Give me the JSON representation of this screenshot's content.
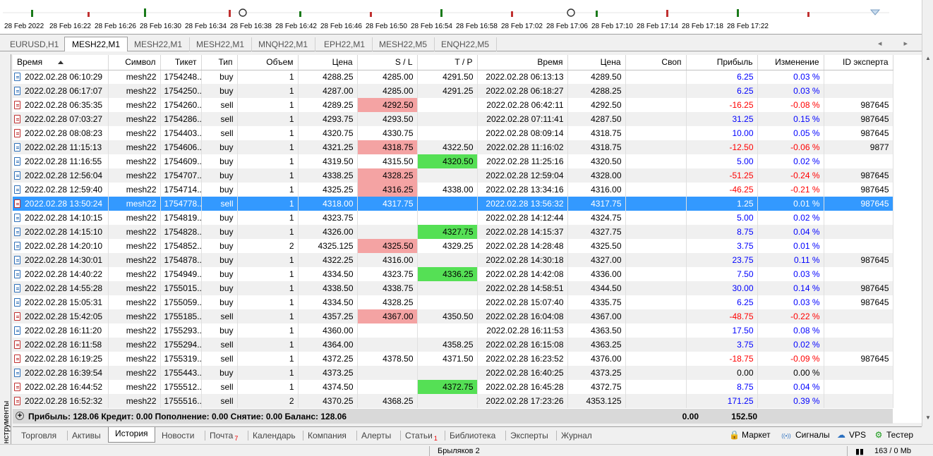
{
  "time_axis": [
    "28 Feb 2022",
    "28 Feb 16:22",
    "28 Feb 16:26",
    "28 Feb 16:30",
    "28 Feb 16:34",
    "28 Feb 16:38",
    "28 Feb 16:42",
    "28 Feb 16:46",
    "28 Feb 16:50",
    "28 Feb 16:54",
    "28 Feb 16:58",
    "28 Feb 17:02",
    "28 Feb 17:06",
    "28 Feb 17:10",
    "28 Feb 17:14",
    "28 Feb 17:18",
    "28 Feb 17:22"
  ],
  "chart_tabs": [
    {
      "label": "EURUSD,H1",
      "active": false
    },
    {
      "label": "MESH22,M1",
      "active": true
    },
    {
      "label": "MESH22,M1",
      "active": false
    },
    {
      "label": "MESH22,M1",
      "active": false
    },
    {
      "label": "MNQH22,M1",
      "active": false
    },
    {
      "label": "EPH22,M1",
      "active": false
    },
    {
      "label": "MESH22,M5",
      "active": false
    },
    {
      "label": "ENQH22,M5",
      "active": false
    }
  ],
  "tab_scroll_arrows": "◂ ▸",
  "side_label": "Инструменты",
  "columns": [
    "Время",
    "Символ",
    "Тикет",
    "Тип",
    "Объем",
    "Цена",
    "S / L",
    "T / P",
    "Время",
    "Цена",
    "Своп",
    "Прибыль",
    "Изменение",
    "ID эксперта"
  ],
  "rows": [
    {
      "open_time": "2022.02.28 06:10:29",
      "symbol": "mesh22",
      "ticket": "1754248...",
      "type": "buy",
      "volume": "1",
      "price": "4288.25",
      "sl": "4285.00",
      "tp": "4291.50",
      "close_time": "2022.02.28 06:13:13",
      "close_price": "4289.50",
      "swap": "",
      "profit": "6.25",
      "change": "0.03 %",
      "expert": "",
      "sl_hit": false,
      "tp_hit": false
    },
    {
      "open_time": "2022.02.28 06:17:07",
      "symbol": "mesh22",
      "ticket": "1754250...",
      "type": "buy",
      "volume": "1",
      "price": "4287.00",
      "sl": "4285.00",
      "tp": "4291.25",
      "close_time": "2022.02.28 06:18:27",
      "close_price": "4288.25",
      "swap": "",
      "profit": "6.25",
      "change": "0.03 %",
      "expert": "",
      "sl_hit": false,
      "tp_hit": false
    },
    {
      "open_time": "2022.02.28 06:35:35",
      "symbol": "mesh22",
      "ticket": "1754260...",
      "type": "sell",
      "volume": "1",
      "price": "4289.25",
      "sl": "4292.50",
      "tp": "",
      "close_time": "2022.02.28 06:42:11",
      "close_price": "4292.50",
      "swap": "",
      "profit": "-16.25",
      "change": "-0.08 %",
      "expert": "987645",
      "sl_hit": true,
      "tp_hit": false
    },
    {
      "open_time": "2022.02.28 07:03:27",
      "symbol": "mesh22",
      "ticket": "1754286...",
      "type": "sell",
      "volume": "1",
      "price": "4293.75",
      "sl": "4293.50",
      "tp": "",
      "close_time": "2022.02.28 07:11:41",
      "close_price": "4287.50",
      "swap": "",
      "profit": "31.25",
      "change": "0.15 %",
      "expert": "987645",
      "sl_hit": false,
      "tp_hit": false
    },
    {
      "open_time": "2022.02.28 08:08:23",
      "symbol": "mesh22",
      "ticket": "1754403...",
      "type": "sell",
      "volume": "1",
      "price": "4320.75",
      "sl": "4330.75",
      "tp": "",
      "close_time": "2022.02.28 08:09:14",
      "close_price": "4318.75",
      "swap": "",
      "profit": "10.00",
      "change": "0.05 %",
      "expert": "987645",
      "sl_hit": false,
      "tp_hit": false
    },
    {
      "open_time": "2022.02.28 11:15:13",
      "symbol": "mesh22",
      "ticket": "1754606...",
      "type": "buy",
      "volume": "1",
      "price": "4321.25",
      "sl": "4318.75",
      "tp": "4322.50",
      "close_time": "2022.02.28 11:16:02",
      "close_price": "4318.75",
      "swap": "",
      "profit": "-12.50",
      "change": "-0.06 %",
      "expert": "9877",
      "sl_hit": true,
      "tp_hit": false
    },
    {
      "open_time": "2022.02.28 11:16:55",
      "symbol": "mesh22",
      "ticket": "1754609...",
      "type": "buy",
      "volume": "1",
      "price": "4319.50",
      "sl": "4315.50",
      "tp": "4320.50",
      "close_time": "2022.02.28 11:25:16",
      "close_price": "4320.50",
      "swap": "",
      "profit": "5.00",
      "change": "0.02 %",
      "expert": "",
      "sl_hit": false,
      "tp_hit": true
    },
    {
      "open_time": "2022.02.28 12:56:04",
      "symbol": "mesh22",
      "ticket": "1754707...",
      "type": "buy",
      "volume": "1",
      "price": "4338.25",
      "sl": "4328.25",
      "tp": "",
      "close_time": "2022.02.28 12:59:04",
      "close_price": "4328.00",
      "swap": "",
      "profit": "-51.25",
      "change": "-0.24 %",
      "expert": "987645",
      "sl_hit": true,
      "tp_hit": false
    },
    {
      "open_time": "2022.02.28 12:59:40",
      "symbol": "mesh22",
      "ticket": "1754714...",
      "type": "buy",
      "volume": "1",
      "price": "4325.25",
      "sl": "4316.25",
      "tp": "4338.00",
      "close_time": "2022.02.28 13:34:16",
      "close_price": "4316.00",
      "swap": "",
      "profit": "-46.25",
      "change": "-0.21 %",
      "expert": "987645",
      "sl_hit": true,
      "tp_hit": false
    },
    {
      "open_time": "2022.02.28 13:50:24",
      "symbol": "mesh22",
      "ticket": "1754778...",
      "type": "sell",
      "volume": "1",
      "price": "4318.00",
      "sl": "4317.75",
      "tp": "",
      "close_time": "2022.02.28 13:56:32",
      "close_price": "4317.75",
      "swap": "",
      "profit": "1.25",
      "change": "0.01 %",
      "expert": "987645",
      "sl_hit": false,
      "tp_hit": false,
      "selected": true
    },
    {
      "open_time": "2022.02.28 14:10:15",
      "symbol": "mesh22",
      "ticket": "1754819...",
      "type": "buy",
      "volume": "1",
      "price": "4323.75",
      "sl": "",
      "tp": "",
      "close_time": "2022.02.28 14:12:44",
      "close_price": "4324.75",
      "swap": "",
      "profit": "5.00",
      "change": "0.02 %",
      "expert": "",
      "sl_hit": false,
      "tp_hit": false
    },
    {
      "open_time": "2022.02.28 14:15:10",
      "symbol": "mesh22",
      "ticket": "1754828...",
      "type": "buy",
      "volume": "1",
      "price": "4326.00",
      "sl": "",
      "tp": "4327.75",
      "close_time": "2022.02.28 14:15:37",
      "close_price": "4327.75",
      "swap": "",
      "profit": "8.75",
      "change": "0.04 %",
      "expert": "",
      "sl_hit": false,
      "tp_hit": true
    },
    {
      "open_time": "2022.02.28 14:20:10",
      "symbol": "mesh22",
      "ticket": "1754852...",
      "type": "buy",
      "volume": "2",
      "price": "4325.125",
      "sl": "4325.50",
      "tp": "4329.25",
      "close_time": "2022.02.28 14:28:48",
      "close_price": "4325.50",
      "swap": "",
      "profit": "3.75",
      "change": "0.01 %",
      "expert": "",
      "sl_hit": true,
      "tp_hit": false
    },
    {
      "open_time": "2022.02.28 14:30:01",
      "symbol": "mesh22",
      "ticket": "1754878...",
      "type": "buy",
      "volume": "1",
      "price": "4322.25",
      "sl": "4316.00",
      "tp": "",
      "close_time": "2022.02.28 14:30:18",
      "close_price": "4327.00",
      "swap": "",
      "profit": "23.75",
      "change": "0.11 %",
      "expert": "987645",
      "sl_hit": false,
      "tp_hit": false
    },
    {
      "open_time": "2022.02.28 14:40:22",
      "symbol": "mesh22",
      "ticket": "1754949...",
      "type": "buy",
      "volume": "1",
      "price": "4334.50",
      "sl": "4323.75",
      "tp": "4336.25",
      "close_time": "2022.02.28 14:42:08",
      "close_price": "4336.00",
      "swap": "",
      "profit": "7.50",
      "change": "0.03 %",
      "expert": "",
      "sl_hit": false,
      "tp_hit": true
    },
    {
      "open_time": "2022.02.28 14:55:28",
      "symbol": "mesh22",
      "ticket": "1755015...",
      "type": "buy",
      "volume": "1",
      "price": "4338.50",
      "sl": "4338.75",
      "tp": "",
      "close_time": "2022.02.28 14:58:51",
      "close_price": "4344.50",
      "swap": "",
      "profit": "30.00",
      "change": "0.14 %",
      "expert": "987645",
      "sl_hit": false,
      "tp_hit": false
    },
    {
      "open_time": "2022.02.28 15:05:31",
      "symbol": "mesh22",
      "ticket": "1755059...",
      "type": "buy",
      "volume": "1",
      "price": "4334.50",
      "sl": "4328.25",
      "tp": "",
      "close_time": "2022.02.28 15:07:40",
      "close_price": "4335.75",
      "swap": "",
      "profit": "6.25",
      "change": "0.03 %",
      "expert": "987645",
      "sl_hit": false,
      "tp_hit": false
    },
    {
      "open_time": "2022.02.28 15:42:05",
      "symbol": "mesh22",
      "ticket": "1755185...",
      "type": "sell",
      "volume": "1",
      "price": "4357.25",
      "sl": "4367.00",
      "tp": "4350.50",
      "close_time": "2022.02.28 16:04:08",
      "close_price": "4367.00",
      "swap": "",
      "profit": "-48.75",
      "change": "-0.22 %",
      "expert": "",
      "sl_hit": true,
      "tp_hit": false
    },
    {
      "open_time": "2022.02.28 16:11:20",
      "symbol": "mesh22",
      "ticket": "1755293...",
      "type": "buy",
      "volume": "1",
      "price": "4360.00",
      "sl": "",
      "tp": "",
      "close_time": "2022.02.28 16:11:53",
      "close_price": "4363.50",
      "swap": "",
      "profit": "17.50",
      "change": "0.08 %",
      "expert": "",
      "sl_hit": false,
      "tp_hit": false
    },
    {
      "open_time": "2022.02.28 16:11:58",
      "symbol": "mesh22",
      "ticket": "1755294...",
      "type": "sell",
      "volume": "1",
      "price": "4364.00",
      "sl": "",
      "tp": "4358.25",
      "close_time": "2022.02.28 16:15:08",
      "close_price": "4363.25",
      "swap": "",
      "profit": "3.75",
      "change": "0.02 %",
      "expert": "",
      "sl_hit": false,
      "tp_hit": false
    },
    {
      "open_time": "2022.02.28 16:19:25",
      "symbol": "mesh22",
      "ticket": "1755319...",
      "type": "sell",
      "volume": "1",
      "price": "4372.25",
      "sl": "4378.50",
      "tp": "4371.50",
      "close_time": "2022.02.28 16:23:52",
      "close_price": "4376.00",
      "swap": "",
      "profit": "-18.75",
      "change": "-0.09 %",
      "expert": "987645",
      "sl_hit": false,
      "tp_hit": false
    },
    {
      "open_time": "2022.02.28 16:39:54",
      "symbol": "mesh22",
      "ticket": "1755443...",
      "type": "buy",
      "volume": "1",
      "price": "4373.25",
      "sl": "",
      "tp": "",
      "close_time": "2022.02.28 16:40:25",
      "close_price": "4373.25",
      "swap": "",
      "profit": "0.00",
      "change": "0.00 %",
      "expert": "",
      "sl_hit": false,
      "tp_hit": false
    },
    {
      "open_time": "2022.02.28 16:44:52",
      "symbol": "mesh22",
      "ticket": "1755512...",
      "type": "sell",
      "volume": "1",
      "price": "4374.50",
      "sl": "",
      "tp": "4372.75",
      "close_time": "2022.02.28 16:45:28",
      "close_price": "4372.75",
      "swap": "",
      "profit": "8.75",
      "change": "0.04 %",
      "expert": "",
      "sl_hit": false,
      "tp_hit": true
    },
    {
      "open_time": "2022.02.28 16:52:32",
      "symbol": "mesh22",
      "ticket": "1755516...",
      "type": "sell",
      "volume": "2",
      "price": "4370.25",
      "sl": "4368.25",
      "tp": "",
      "close_time": "2022.02.28 17:23:26",
      "close_price": "4353.125",
      "swap": "",
      "profit": "171.25",
      "change": "0.39 %",
      "expert": "",
      "sl_hit": false,
      "tp_hit": false
    }
  ],
  "summary": {
    "text": "Прибыль: 128.06  Кредит: 0.00  Пополнение: 0.00  Снятие: 0.00  Баланс: 128.06",
    "swap": "0.00",
    "profit": "152.50"
  },
  "bottom_tabs": [
    {
      "label": "Торговля",
      "active": false,
      "badge": ""
    },
    {
      "label": "Активы",
      "active": false,
      "badge": ""
    },
    {
      "label": "История",
      "active": true,
      "badge": ""
    },
    {
      "label": "Новости",
      "active": false,
      "badge": ""
    },
    {
      "label": "Почта",
      "active": false,
      "badge": "7"
    },
    {
      "label": "Календарь",
      "active": false,
      "badge": ""
    },
    {
      "label": "Компания",
      "active": false,
      "badge": ""
    },
    {
      "label": "Алерты",
      "active": false,
      "badge": ""
    },
    {
      "label": "Статьи",
      "active": false,
      "badge": "1"
    },
    {
      "label": "Библиотека",
      "active": false,
      "badge": ""
    },
    {
      "label": "Эксперты",
      "active": false,
      "badge": ""
    },
    {
      "label": "Журнал",
      "active": false,
      "badge": ""
    }
  ],
  "right_tools": [
    {
      "label": "Маркет",
      "icon": "market-bag-icon"
    },
    {
      "label": "Сигналы",
      "icon": "signals-icon"
    },
    {
      "label": "VPS",
      "icon": "vps-cloud-icon"
    },
    {
      "label": "Тестер",
      "icon": "tester-gear-icon"
    }
  ],
  "status": {
    "profile": "Брыляков 2",
    "traffic": "163 / 0 Mb"
  },
  "colors": {
    "profit_positive": "#0000ff",
    "profit_negative": "#ff0000",
    "sl_hit": "#f4a3a3",
    "tp_hit": "#55e055",
    "selected_row": "#3399ff"
  }
}
